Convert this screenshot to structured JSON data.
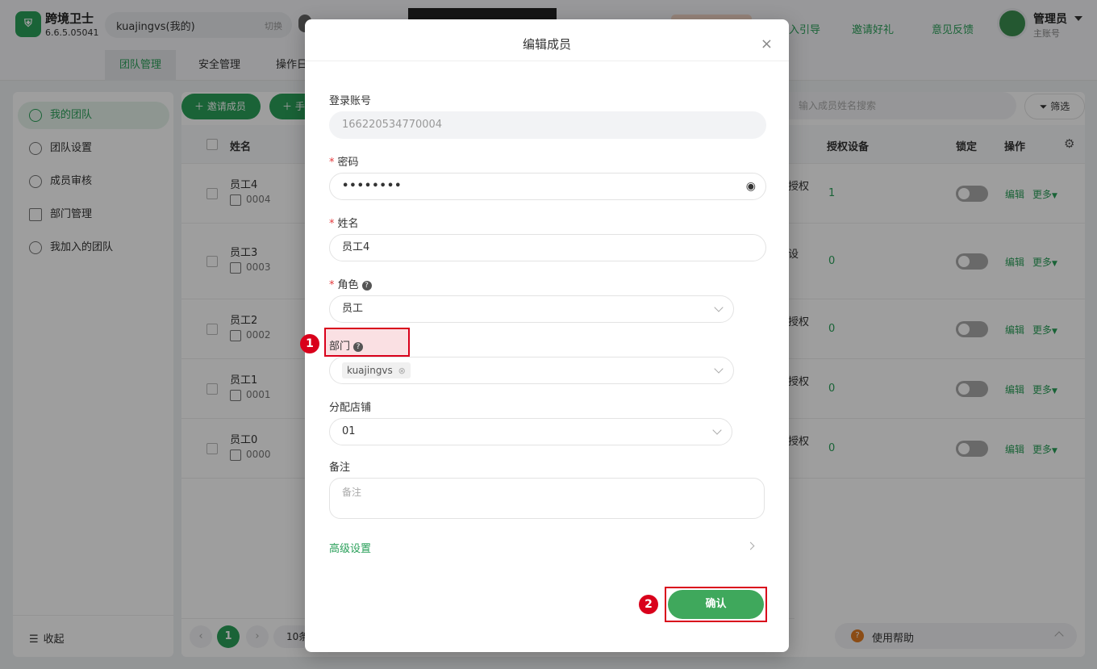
{
  "app": {
    "name": "跨境卫士",
    "version": "6.6.5.05041"
  },
  "header": {
    "account": "kuajingvs(我的)",
    "switch_label": "切换",
    "links": [
      "入引导",
      "邀请好礼",
      "意见反馈"
    ],
    "user": {
      "role": "管理员",
      "sub": "主账号"
    }
  },
  "tabs": [
    "团队管理",
    "安全管理",
    "操作日"
  ],
  "sidebar": {
    "items": [
      "我的团队",
      "团队设置",
      "成员审核",
      "部门管理",
      "我加入的团队"
    ],
    "collapse": "收起"
  },
  "toolbar": {
    "invite": "邀请成员",
    "add_prefix": "手",
    "search_placeholder": "输入成员姓名搜索",
    "filter": "筛选"
  },
  "table": {
    "headers": {
      "name": "姓名",
      "devices": "授权设备",
      "lock": "锁定",
      "actions": "操作"
    },
    "rows": [
      {
        "name": "员工4",
        "id": "0004",
        "auth": "授权",
        "devices": "1",
        "edit": "编辑",
        "more": "更多"
      },
      {
        "name": "员工3",
        "id": "0003",
        "auth": "设",
        "devices": "0",
        "edit": "编辑",
        "more": "更多"
      },
      {
        "name": "员工2",
        "id": "0002",
        "auth": "授权",
        "devices": "0",
        "edit": "编辑",
        "more": "更多"
      },
      {
        "name": "员工1",
        "id": "0001",
        "auth": "授权",
        "devices": "0",
        "edit": "编辑",
        "more": "更多"
      },
      {
        "name": "员工0",
        "id": "0000",
        "auth": "授权",
        "devices": "0",
        "edit": "编辑",
        "more": "更多"
      }
    ]
  },
  "pagination": {
    "current": "1",
    "size_prefix": "10条"
  },
  "help": {
    "label": "使用帮助"
  },
  "modal": {
    "title": "编辑成员",
    "account_label": "登录账号",
    "account_value": "166220534770004",
    "password_label": "密码",
    "password_value": "••••••••",
    "name_label": "姓名",
    "name_value": "员工4",
    "role_label": "角色",
    "role_value": "员工",
    "dept_label": "部门",
    "dept_tag": "kuajingvs",
    "store_label": "分配店铺",
    "store_value": "01",
    "note_label": "备注",
    "note_placeholder": "备注",
    "advanced": "高级设置",
    "confirm": "确认"
  },
  "annotations": {
    "step1": "1",
    "step2": "2"
  },
  "colors": {
    "accent": "#2aa05a",
    "highlight": "#d9001b"
  }
}
